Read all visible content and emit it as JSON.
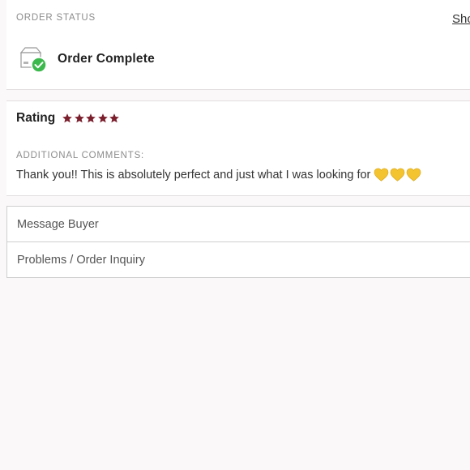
{
  "order_status": {
    "section_label": "ORDER STATUS",
    "show_link_label": "Sho",
    "status_text": "Order Complete",
    "status_icon": "box-check-icon"
  },
  "review": {
    "rating_label": "Rating",
    "rating_value": 5,
    "rating_max": 5,
    "star_color": "#7b1f2d",
    "comments_label": "ADDITIONAL COMMENTS:",
    "comment_text": "Thank you!! This is absolutely perfect and just what I was looking for",
    "comment_emoji": [
      "yellow-heart-icon",
      "yellow-heart-icon",
      "yellow-heart-icon"
    ]
  },
  "actions": [
    {
      "label": "Message Buyer"
    },
    {
      "label": "Problems / Order Inquiry"
    }
  ],
  "colors": {
    "success_green": "#3cb94d",
    "star": "#7b1f2d",
    "heart": "#f4c430"
  }
}
